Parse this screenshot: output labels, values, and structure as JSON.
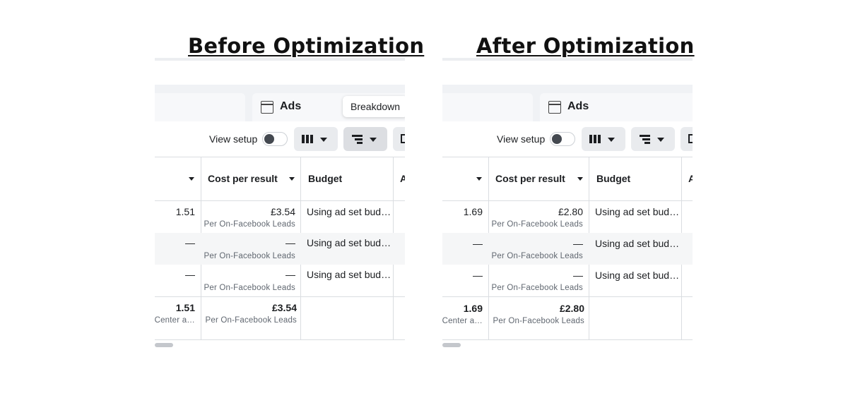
{
  "panels": [
    {
      "heading": "Before Optimization",
      "tab_label": "Ads",
      "tooltip": "Breakdown",
      "view_setup_label": "View setup",
      "columns": {
        "cost_per_result": "Cost per result",
        "budget": "Budget",
        "next_cut": "A"
      },
      "rows": [
        {
          "results": "1.51",
          "cost": "£3.54",
          "cost_sub": "Per On-Facebook Leads",
          "budget": "Using ad set bud…"
        },
        {
          "results": "—",
          "cost": "—",
          "cost_sub": "Per On-Facebook Leads",
          "budget": "Using ad set bud…"
        },
        {
          "results": "—",
          "cost": "—",
          "cost_sub": "Per On-Facebook Leads",
          "budget": "Using ad set bud…"
        }
      ],
      "total": {
        "results": "1.51",
        "results_sub": "s Center a…",
        "cost": "£3.54",
        "cost_sub": "Per On-Facebook Leads"
      }
    },
    {
      "heading": "After Optimization",
      "tab_label": "Ads",
      "view_setup_label": "View setup",
      "columns": {
        "cost_per_result": "Cost per result",
        "budget": "Budget",
        "next_cut": "A"
      },
      "rows": [
        {
          "results": "1.69",
          "cost": "£2.80",
          "cost_sub": "Per On-Facebook Leads",
          "budget": "Using ad set bud…"
        },
        {
          "results": "—",
          "cost": "—",
          "cost_sub": "Per On-Facebook Leads",
          "budget": "Using ad set bud…"
        },
        {
          "results": "—",
          "cost": "—",
          "cost_sub": "Per On-Facebook Leads",
          "budget": "Using ad set bud…"
        }
      ],
      "total": {
        "results": "1.69",
        "results_sub": "s Center a…",
        "cost": "£2.80",
        "cost_sub": "Per On-Facebook Leads"
      }
    }
  ],
  "icons": {
    "tab": "ads-window-icon",
    "columns": "columns-icon",
    "breakdown": "breakdown-icon",
    "dropdown": "chevron-down-icon",
    "sort": "sort-caret-icon"
  },
  "colors": {
    "background": "#ffffff",
    "tab_bar": "#f0f2f5",
    "button": "#e9ebee",
    "button_active": "#dcdee2",
    "shaded_row": "#f5f6f7",
    "border": "#dadde1",
    "text": "#1c1e21",
    "subtext": "#606770"
  }
}
